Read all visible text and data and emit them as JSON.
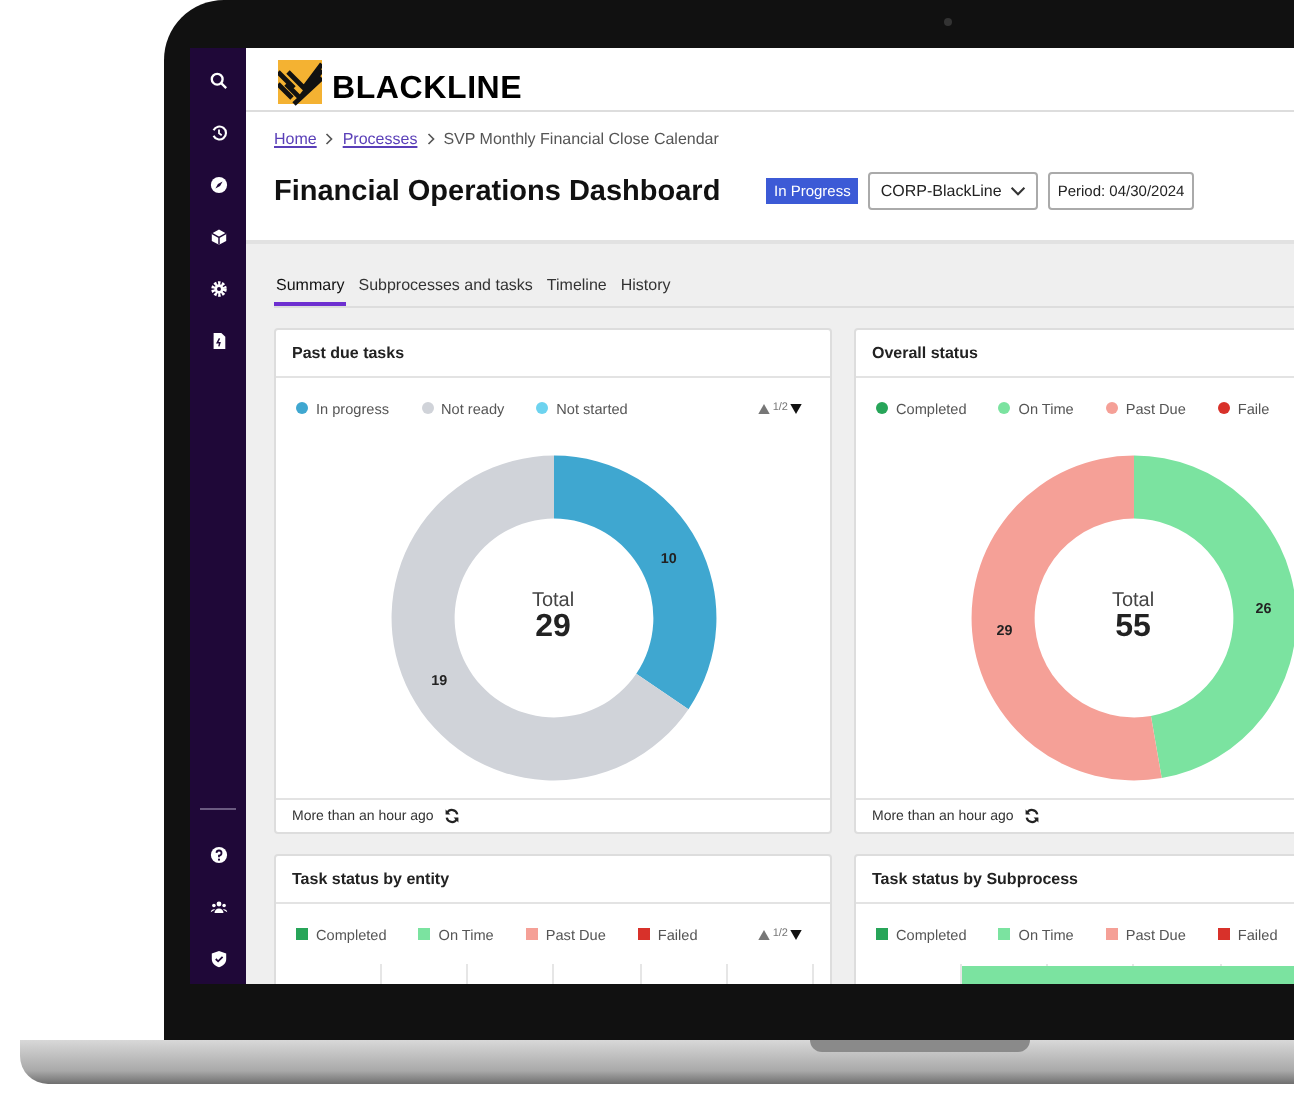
{
  "logo": {
    "text": "BLACKLINE"
  },
  "breadcrumb": [
    {
      "label": "Home",
      "link": true
    },
    {
      "label": "Processes",
      "link": true
    },
    {
      "label": "SVP Monthly Financial Close Calendar",
      "link": false
    }
  ],
  "title": "Financial Operations Dashboard",
  "status_badge": "In Progress",
  "entity_dropdown": {
    "value": "CORP-BlackLine"
  },
  "period": "Period: 04/30/2024",
  "tabs": [
    {
      "label": "Summary",
      "selected": true
    },
    {
      "label": "Subprocesses and tasks",
      "selected": false
    },
    {
      "label": "Timeline",
      "selected": false
    },
    {
      "label": "History",
      "selected": false
    }
  ],
  "cards": [
    {
      "title": "Past due tasks",
      "kind": "donut",
      "pager": "1/2",
      "legend": [
        {
          "color": "#3fa7d0"
        },
        {
          "color": "#d0d3d9"
        },
        {
          "color": "#6dd3ef"
        }
      ],
      "center_label": "Total",
      "total": "29",
      "chart_data": {
        "type": "donut",
        "categories": [
          "In progress",
          "Not ready",
          "Not started"
        ],
        "values": [
          10,
          19,
          0
        ],
        "data_labels": true
      },
      "footer": "More than an hour ago"
    },
    {
      "title": "Overall status",
      "kind": "donut",
      "legend": [
        {
          "color": "#27a559"
        },
        {
          "color": "#7be3a0"
        },
        {
          "color": "#f5a097"
        },
        {
          "color": "#d8312a"
        }
      ],
      "center_label": "Total",
      "total": "55",
      "chart_data": {
        "type": "donut",
        "categories": [
          "Completed",
          "On Time",
          "Past Due",
          "Faile"
        ],
        "values": [
          0,
          26,
          29,
          0
        ],
        "data_labels": true
      },
      "footer": "More than an hour ago"
    },
    {
      "title": "Task status by entity",
      "kind": "bar",
      "pager": "1/2",
      "legend": [
        {
          "label": "Completed",
          "color": "#27a559"
        },
        {
          "label": "On Time",
          "color": "#7be3a0"
        },
        {
          "label": "Past Due",
          "color": "#f5a097"
        },
        {
          "label": "Failed",
          "color": "#d8312a"
        }
      ]
    },
    {
      "title": "Task status by Subprocess",
      "kind": "bar",
      "legend": [
        {
          "label": "Completed",
          "color": "#27a559"
        },
        {
          "label": "On Time",
          "color": "#7be3a0"
        },
        {
          "label": "Past Due",
          "color": "#f5a097"
        },
        {
          "label": "Failed",
          "color": "#d8312a"
        }
      ]
    }
  ]
}
